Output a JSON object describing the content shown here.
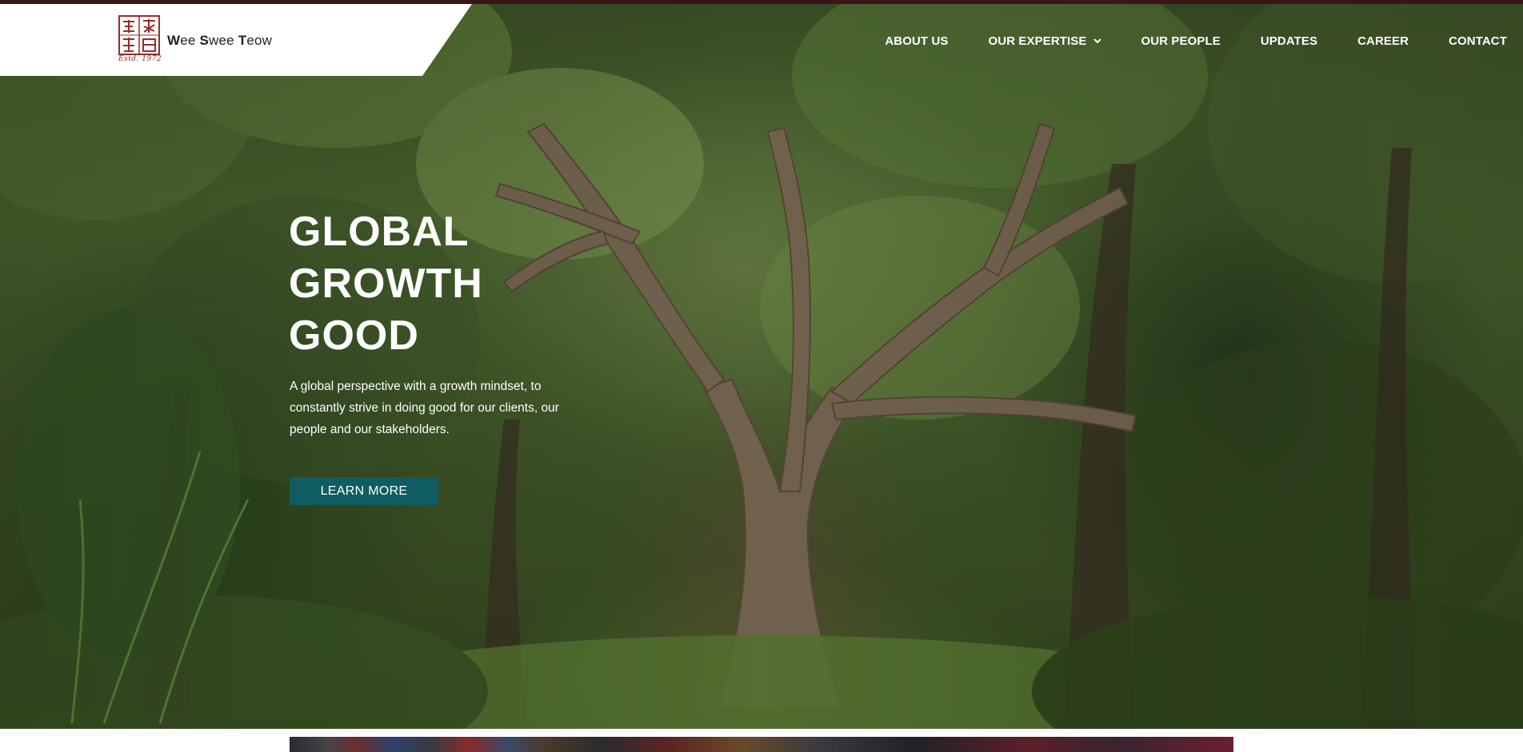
{
  "brand": {
    "name_parts": [
      "W",
      "ee ",
      "S",
      "wee ",
      "T",
      "eow"
    ],
    "estd": "Estd. 1972"
  },
  "nav": {
    "items": [
      {
        "label": "ABOUT US"
      },
      {
        "label": "OUR EXPERTISE",
        "has_dropdown": true,
        "icon": "chevron-down-icon"
      },
      {
        "label": "OUR PEOPLE"
      },
      {
        "label": "UPDATES"
      },
      {
        "label": "CAREER"
      },
      {
        "label": "CONTACT"
      }
    ]
  },
  "hero": {
    "title_lines": [
      "GLOBAL",
      "GROWTH",
      "GOOD"
    ],
    "description": "A global perspective with a growth mindset, to constantly strive in doing good for our clients, our people and our stakeholders.",
    "cta_label": "LEARN MORE"
  },
  "colors": {
    "accent": "#0f5c63",
    "brand_seal": "#9b2a2a",
    "top_strip": "#3a1515",
    "nav_text": "#ffffff"
  }
}
